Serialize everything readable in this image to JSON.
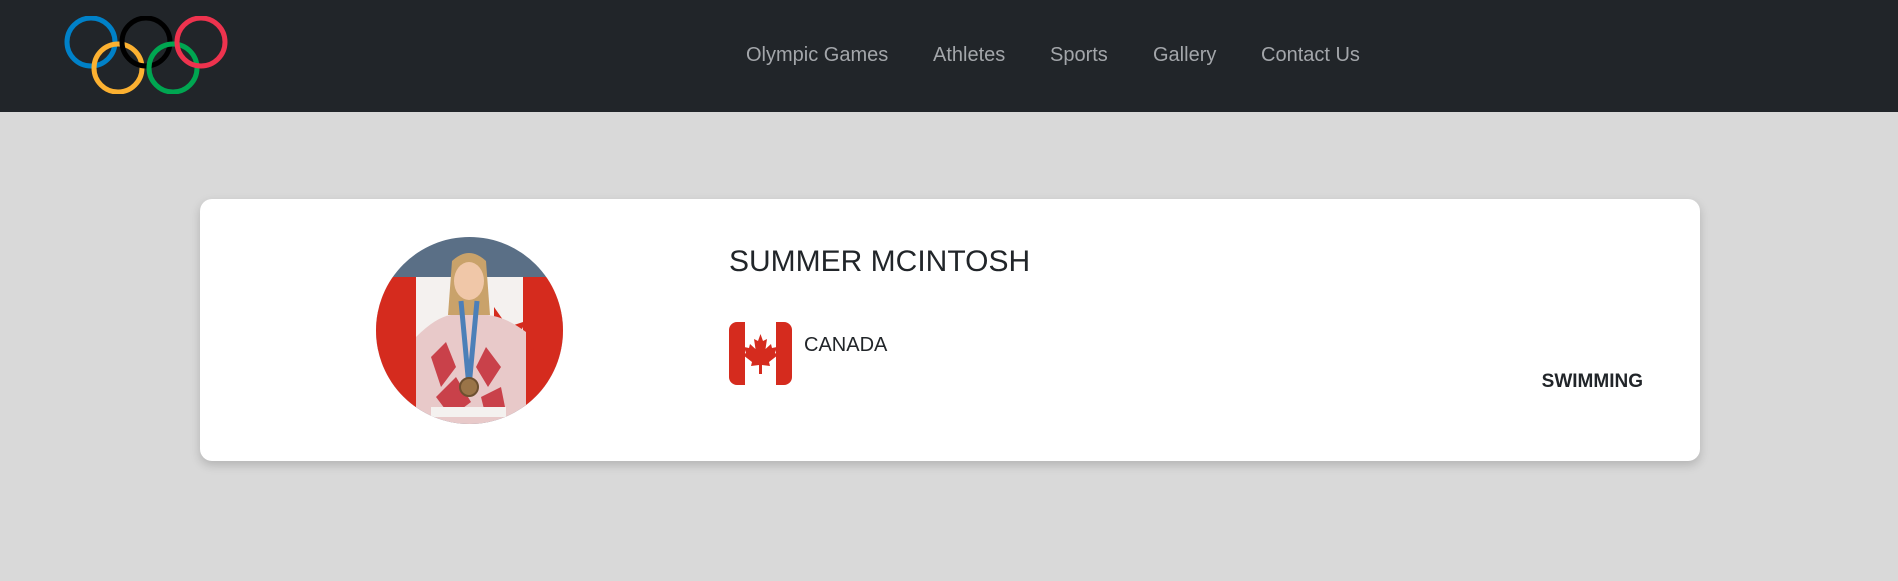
{
  "nav": {
    "logo_icon": "olympic-rings-icon",
    "links": [
      "Olympic Games",
      "Athletes",
      "Sports",
      "Gallery",
      "Contact Us"
    ]
  },
  "athlete": {
    "name": "SUMMER MCINTOSH",
    "country": "CANADA",
    "flag_icon": "canada-flag-icon",
    "sport": "SWIMMING"
  },
  "colors": {
    "navbar_bg": "#212529",
    "page_bg": "#d9d9d9",
    "nav_link": "#a3a6aa",
    "ring_blue": "#0081c8",
    "ring_black": "#000000",
    "ring_red": "#ee334e",
    "ring_yellow": "#fcb131",
    "ring_green": "#00a651",
    "flag_red": "#d52b1e"
  }
}
